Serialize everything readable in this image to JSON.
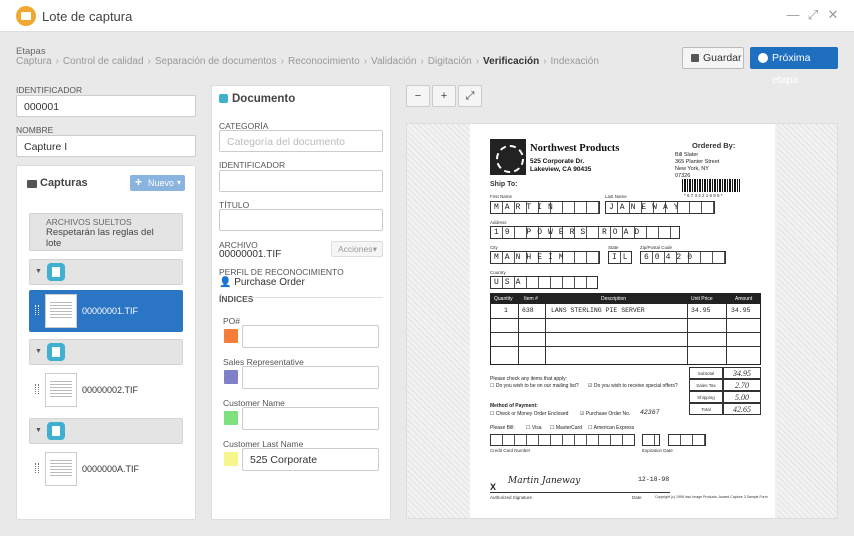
{
  "window": {
    "title": "Lote de captura"
  },
  "stages": {
    "label": "Etapas",
    "items": [
      "Captura",
      "Control de calidad",
      "Separación de documentos",
      "Reconocimiento",
      "Validación",
      "Digitación",
      "Verificación",
      "Indexación"
    ],
    "active_index": 6
  },
  "actions": {
    "save_label": "Guardar",
    "next_label": "Próxima etapa"
  },
  "form": {
    "identificador_label": "IDENTIFICADOR",
    "identificador_value": "000001",
    "nombre_label": "NOMBRE",
    "nombre_value": "Capture I"
  },
  "captures": {
    "title": "Capturas",
    "new_label": "Nuevo",
    "loose_title": "ARCHIVOS SUELTOS",
    "loose_text": "Respetarán las reglas del lote",
    "files": [
      "00000001.TIF",
      "00000002.TIF",
      "0000000A.TIF"
    ]
  },
  "document": {
    "title": "Documento",
    "categoria_label": "CATEGORÍA",
    "categoria_placeholder": "Categoría del documento",
    "identificador_label": "IDENTIFICADOR",
    "titulo_label": "TÍTULO",
    "archivo_label": "ARCHIVO",
    "archivo_value": "00000001.TIF",
    "acciones_label": "Acciones",
    "perfil_label": "PERFIL DE RECONOCIMIENTO",
    "perfil_value": "Purchase Order",
    "indices_label": "ÍNDICES",
    "indices": [
      {
        "label": "PO#",
        "value": "",
        "color": "#f57e3c"
      },
      {
        "label": "Sales Representative",
        "value": "",
        "color": "#8080c8"
      },
      {
        "label": "Customer Name",
        "value": "",
        "color": "#7fe07f"
      },
      {
        "label": "Customer Last Name",
        "value": "525 Corporate",
        "color": "#f6f68a"
      }
    ]
  },
  "viewer_doc": {
    "company": "Northwest Products",
    "addr1": "525 Corporate Dr.",
    "addr2": "Lakeview, CA  90435",
    "ordered_by": "Ordered By:",
    "ord_name": "Bill Slater",
    "ord_street": "365 Planter Street",
    "ord_city": "New York, NY",
    "ord_zip": "07326",
    "barcode_text": "* 6 7 3 4 2 1 6 9 5 *",
    "ship_to": "Ship To:",
    "first_name_lbl": "First Name",
    "last_name_lbl": "Last Name",
    "first_name": "MARTIN",
    "last_name": "JANEWAY",
    "address_lbl": "Address",
    "address": "19 POWERS ROAD",
    "city_lbl": "City",
    "state_lbl": "State",
    "zip_lbl": "Zip/Postal Code",
    "city": "MANHEIM",
    "state": "IL",
    "zip": "60420",
    "country_lbl": "Country",
    "country": "USA",
    "th_qty": "Quantity",
    "th_item": "Item #",
    "th_desc": "Description",
    "th_unit": "Unit Price",
    "th_amount": "Amount",
    "row_qty": "1",
    "row_item": "638",
    "row_desc": "LANS STERLING PIE SERVER",
    "row_unit": "34.95",
    "row_amount": "34.95",
    "subtotal_lbl": "Subtotal",
    "subtotal": "34.95",
    "tax_lbl": "Sales Tax",
    "tax": "2.70",
    "shipping_lbl": "Shipping",
    "shipping": "5.00",
    "total_lbl": "Total",
    "total": "42.65",
    "check_items": "Please check any items that apply:",
    "mailing": "Do you wish to be on our mailing list?",
    "offers": "Do you wish to receive special offers?",
    "payment_lbl": "Method of Payment:",
    "pay_check": "Check or Money Order Enclosed",
    "pay_po": "Purchase Order No.",
    "po_value": "42367",
    "bill_lbl": "Please Bill:",
    "visa": "Visa",
    "mastercard": "MasterCard",
    "amex": "American Express",
    "cc_lbl": "Credit Card Number",
    "exp_lbl": "Expiration Date",
    "signature": "Martin Janeway",
    "date_value": "12-18-98",
    "x_mark": "X",
    "sig_lbl": "Authorized Signature",
    "date_lbl": "Date",
    "copyright": "Copyright (c) 1998 Inso Image Products. Ascent Capture 3 Sample Form"
  }
}
